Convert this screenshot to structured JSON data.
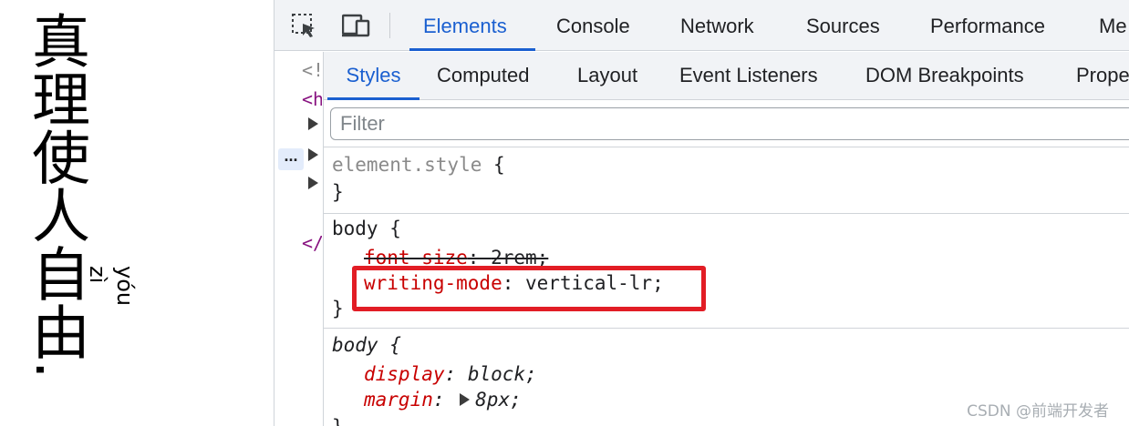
{
  "page": {
    "text": "真理使人自由.",
    "ruby_zi": "zì",
    "ruby_you": "yóu"
  },
  "toolbar": {
    "inspect_icon": "inspect-element-icon",
    "device_icon": "device-toolbar-icon",
    "tabs": [
      "Elements",
      "Console",
      "Network",
      "Sources",
      "Performance",
      "Me"
    ]
  },
  "dom_tree": {
    "fragments": [
      "<!",
      "<h",
      "</"
    ],
    "selected_marker": "..."
  },
  "styles": {
    "sub_tabs": [
      "Styles",
      "Computed",
      "Layout",
      "Event Listeners",
      "DOM Breakpoints",
      "Prope"
    ],
    "filter_placeholder": "Filter",
    "rules": {
      "element_style": {
        "selector": "element.style",
        "open": " {",
        "close": "}"
      },
      "body_author": {
        "selector": "body",
        "open": " {",
        "close": "}",
        "decl1_prop": "font-size",
        "decl1_val": "2rem;",
        "decl2_prop": "writing-mode",
        "decl2_val": "vertical-lr;"
      },
      "body_ua": {
        "selector": "body",
        "open": " {",
        "close": "}",
        "decl1_prop": "display",
        "decl1_val": "block;",
        "decl2_prop": "margin",
        "decl2_val": "8px;"
      }
    }
  },
  "watermark": "CSDN @前端开发者",
  "colors": {
    "accent": "#1a5fd0",
    "property": "#c80000",
    "highlight": "#e21d25"
  }
}
